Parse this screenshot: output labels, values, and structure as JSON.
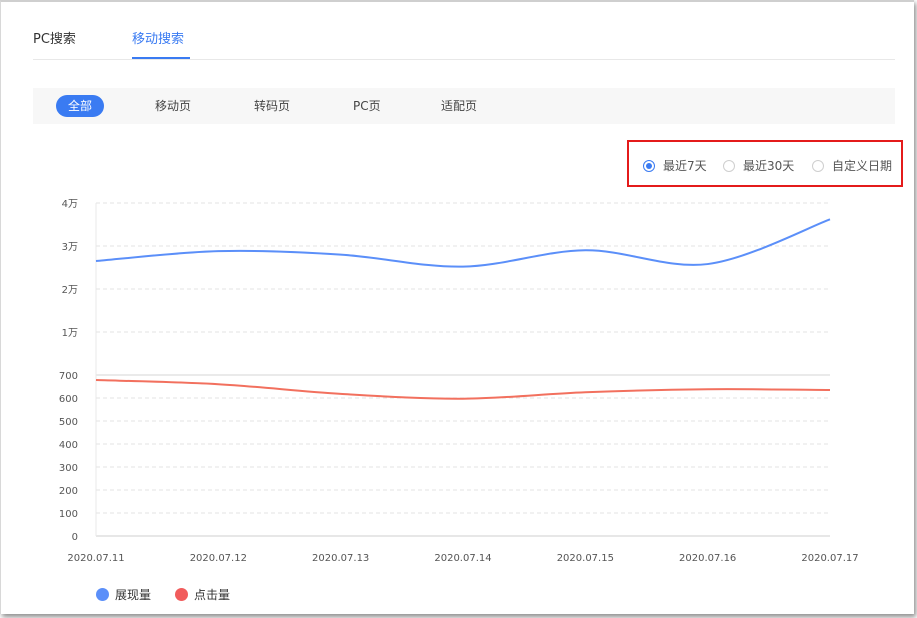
{
  "tabs": [
    {
      "label": "PC搜索",
      "active": false
    },
    {
      "label": "移动搜索",
      "active": true
    }
  ],
  "filters": [
    {
      "label": "全部",
      "active": true
    },
    {
      "label": "移动页",
      "active": false
    },
    {
      "label": "转码页",
      "active": false
    },
    {
      "label": "PC页",
      "active": false
    },
    {
      "label": "适配页",
      "active": false
    }
  ],
  "date_range": {
    "options": [
      {
        "label": "最近7天",
        "checked": true
      },
      {
        "label": "最近30天",
        "checked": false
      },
      {
        "label": "自定义日期",
        "checked": false
      }
    ],
    "highlight_color": "#e41b1b"
  },
  "colors": {
    "accent": "#3a7bf2",
    "impressions": "#5b8ff9",
    "clicks": "#f2705e"
  },
  "chart_data": {
    "type": "line",
    "x": [
      "2020.07.11",
      "2020.07.12",
      "2020.07.13",
      "2020.07.14",
      "2020.07.15",
      "2020.07.16",
      "2020.07.17"
    ],
    "series": [
      {
        "name": "展现量",
        "color": "#5b8ff9",
        "axis": "upper",
        "values": [
          26500,
          28800,
          28000,
          25200,
          29000,
          25800,
          36200
        ]
      },
      {
        "name": "点击量",
        "color": "#f2705e",
        "axis": "lower",
        "values": [
          678,
          660,
          618,
          597,
          625,
          638,
          635
        ]
      }
    ],
    "upper_axis": {
      "ticks": [
        "4万",
        "3万",
        "2万",
        "1万"
      ],
      "ylim": [
        0,
        40000
      ]
    },
    "lower_axis": {
      "ticks": [
        "700",
        "600",
        "500",
        "400",
        "300",
        "200",
        "100",
        "0"
      ],
      "ylim": [
        0,
        700
      ]
    },
    "grid": true,
    "legend": "bottom-left"
  }
}
